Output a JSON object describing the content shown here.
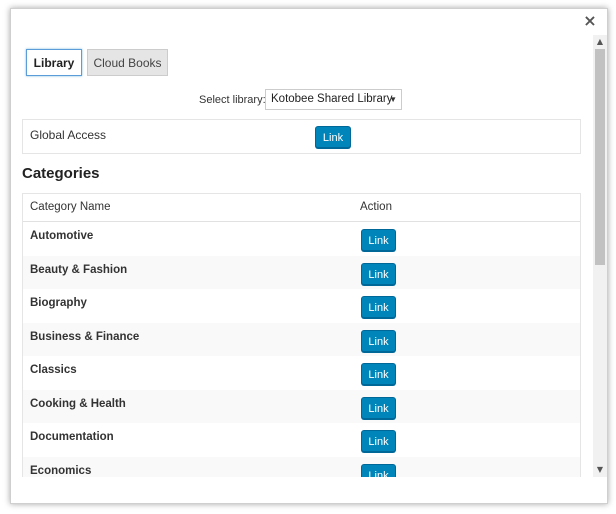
{
  "dialog": {
    "close_glyph": "×"
  },
  "tabs": [
    {
      "label": "Library",
      "active": true
    },
    {
      "label": "Cloud Books",
      "active": false
    }
  ],
  "library_select": {
    "label": "Select library:",
    "value": "Kotobee Shared Library"
  },
  "global_access": {
    "label": "Global Access",
    "button_label": "Link"
  },
  "categories": {
    "heading": "Categories",
    "columns": [
      "Category Name",
      "Action"
    ],
    "rows": [
      {
        "name": "Automotive",
        "action": "Link"
      },
      {
        "name": "Beauty & Fashion",
        "action": "Link"
      },
      {
        "name": "Biography",
        "action": "Link"
      },
      {
        "name": "Business & Finance",
        "action": "Link"
      },
      {
        "name": "Classics",
        "action": "Link"
      },
      {
        "name": "Cooking & Health",
        "action": "Link"
      },
      {
        "name": "Documentation",
        "action": "Link"
      },
      {
        "name": "Economics",
        "action": "Link"
      }
    ]
  },
  "colors": {
    "button_bg": "#0085ba",
    "active_tab_border": "#5b9dd9",
    "inactive_tab_bg": "#e5e5e5"
  }
}
